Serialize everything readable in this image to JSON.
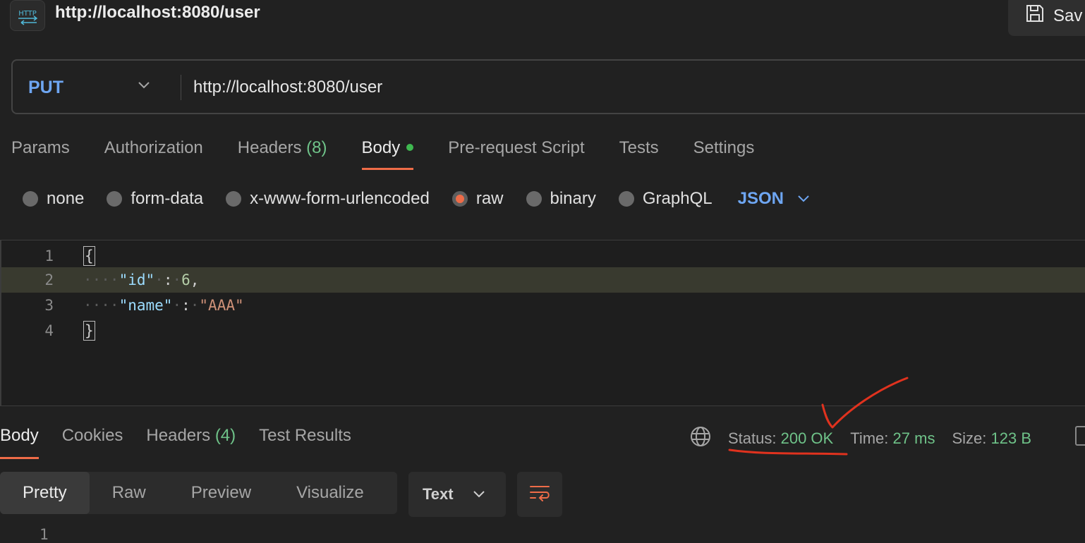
{
  "header": {
    "icon": "http-icon",
    "icon_label": "HTTP",
    "title": "http://localhost:8080/user",
    "save_label": "Sav"
  },
  "request": {
    "method": "PUT",
    "url": "http://localhost:8080/user"
  },
  "request_tabs": [
    {
      "label": "Params",
      "count": ""
    },
    {
      "label": "Authorization",
      "count": ""
    },
    {
      "label": "Headers",
      "count": "(8)"
    },
    {
      "label": "Body",
      "count": ""
    },
    {
      "label": "Pre-request Script",
      "count": ""
    },
    {
      "label": "Tests",
      "count": ""
    },
    {
      "label": "Settings",
      "count": ""
    }
  ],
  "body_types": [
    {
      "label": "none",
      "selected": false
    },
    {
      "label": "form-data",
      "selected": false
    },
    {
      "label": "x-www-form-urlencoded",
      "selected": false
    },
    {
      "label": "raw",
      "selected": true
    },
    {
      "label": "binary",
      "selected": false
    },
    {
      "label": "GraphQL",
      "selected": false
    }
  ],
  "body_format": "JSON",
  "editor": {
    "line_numbers": [
      "1",
      "2",
      "3",
      "4"
    ],
    "open_brace": "{",
    "close_brace": "}",
    "key_id": "\"id\"",
    "colon": ":",
    "value_id": "6",
    "comma": ",",
    "key_name": "\"name\"",
    "value_name": "\"AAA\""
  },
  "response_tabs": [
    {
      "label": "Body",
      "count": ""
    },
    {
      "label": "Cookies",
      "count": ""
    },
    {
      "label": "Headers",
      "count": "(4)"
    },
    {
      "label": "Test Results",
      "count": ""
    }
  ],
  "response_meta": {
    "status_label": "Status:",
    "status_value": "200 OK",
    "time_label": "Time:",
    "time_value": "27 ms",
    "size_label": "Size:",
    "size_value": "123 B"
  },
  "view_modes": [
    "Pretty",
    "Raw",
    "Preview",
    "Visualize"
  ],
  "response_format": "Text",
  "response_line_number": "1",
  "colors": {
    "accent": "#ef6c48",
    "method": "#6ea6f2",
    "success": "#6fc389",
    "annotation": "#e0321e"
  }
}
